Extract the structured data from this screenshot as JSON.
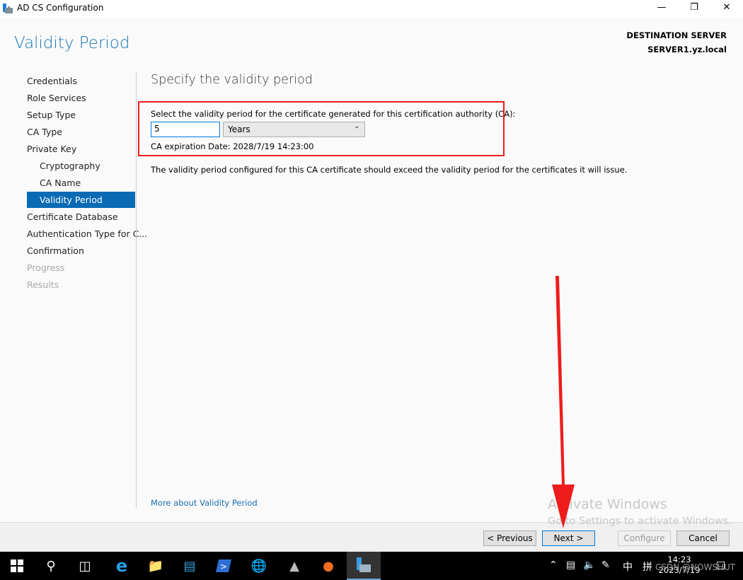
{
  "window": {
    "title": "AD CS Configuration",
    "page_title": "Validity Period",
    "destination_label": "DESTINATION SERVER",
    "destination_server": "SERVER1.yz.local"
  },
  "nav": [
    {
      "label": "Credentials",
      "state": "normal"
    },
    {
      "label": "Role Services",
      "state": "normal"
    },
    {
      "label": "Setup Type",
      "state": "normal"
    },
    {
      "label": "CA Type",
      "state": "normal"
    },
    {
      "label": "Private Key",
      "state": "normal"
    },
    {
      "label": "Cryptography",
      "state": "sub"
    },
    {
      "label": "CA Name",
      "state": "sub"
    },
    {
      "label": "Validity Period",
      "state": "selected"
    },
    {
      "label": "Certificate Database",
      "state": "normal"
    },
    {
      "label": "Authentication Type for C...",
      "state": "normal"
    },
    {
      "label": "Confirmation",
      "state": "normal"
    },
    {
      "label": "Progress",
      "state": "disabled"
    },
    {
      "label": "Results",
      "state": "disabled"
    }
  ],
  "main": {
    "heading": "Specify the validity period",
    "prompt": "Select the validity period for the certificate generated for this certification authority (CA):",
    "period_value": "5",
    "period_unit": "Years",
    "expiration": "CA expiration Date: 2028/7/19 14:23:00",
    "note": "The validity period configured for this CA certificate should exceed the validity period for the certificates it will issue.",
    "more_link": "More about Validity Period"
  },
  "watermark": {
    "line1": "Activate Windows",
    "line2": "Go to Settings to activate Windows."
  },
  "buttons": {
    "previous": "< Previous",
    "next": "Next >",
    "configure": "Configure",
    "cancel": "Cancel"
  },
  "taskbar": {
    "ime1": "中",
    "ime2": "拼",
    "time": "14:23",
    "date": "2023/7/19",
    "overlay_text": "CSDN @NOWSHUT"
  },
  "colors": {
    "accent": "#0a6bb5",
    "annotation": "#ee1c1c"
  }
}
